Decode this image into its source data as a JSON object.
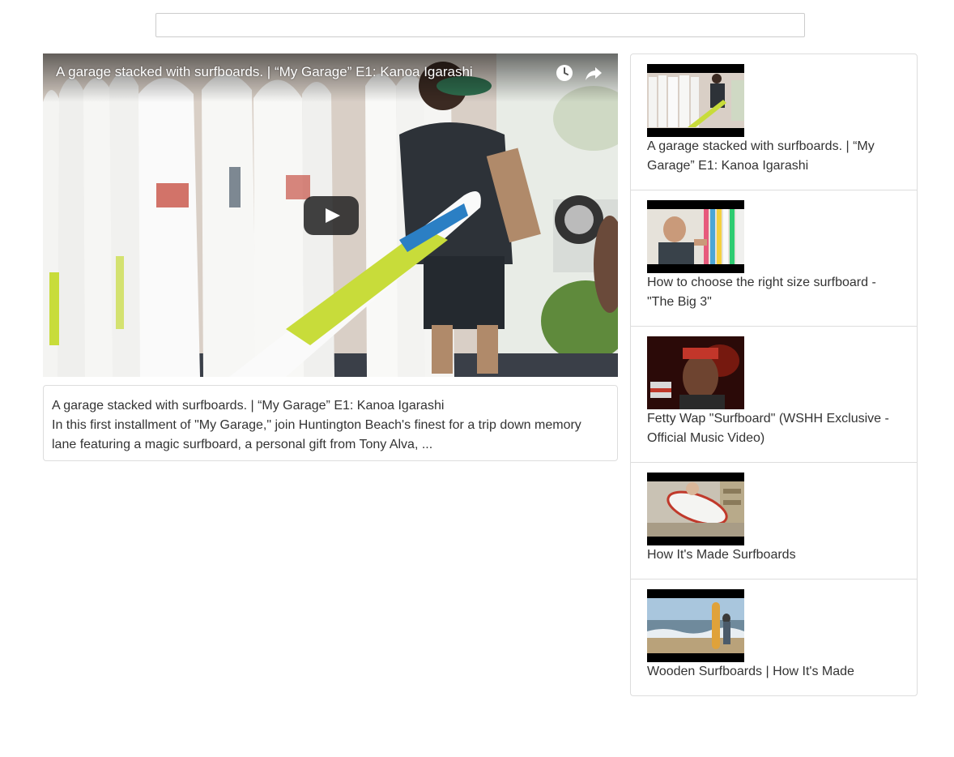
{
  "search": {
    "value": "",
    "placeholder": ""
  },
  "player": {
    "title": "A garage stacked with surfboards. | “My Garage” E1: Kanoa Igarashi",
    "icons": [
      "watch-later-icon",
      "share-icon",
      "play-icon"
    ]
  },
  "description": {
    "title": "A garage stacked with surfboards. | “My Garage” E1: Kanoa Igarashi",
    "text": "In this first installment of \"My Garage,\" join Huntington Beach's finest for a trip down memory lane featuring a magic surfboard, a personal gift from Tony Alva, ..."
  },
  "playlist": {
    "items": [
      {
        "label": "A garage stacked with surfboards. | “My Garage” E1: Kanoa Igarashi"
      },
      {
        "label": "How to choose the right size surfboard - \"The Big 3\""
      },
      {
        "label": "Fetty Wap \"Surfboard\" (WSHH Exclusive - Official Music Video)"
      },
      {
        "label": "How It's Made Surfboards"
      },
      {
        "label": "Wooden Surfboards | How It's Made"
      }
    ]
  },
  "colors": {
    "text": "#333333",
    "border": "#dddddd",
    "play_button": "#212121"
  }
}
